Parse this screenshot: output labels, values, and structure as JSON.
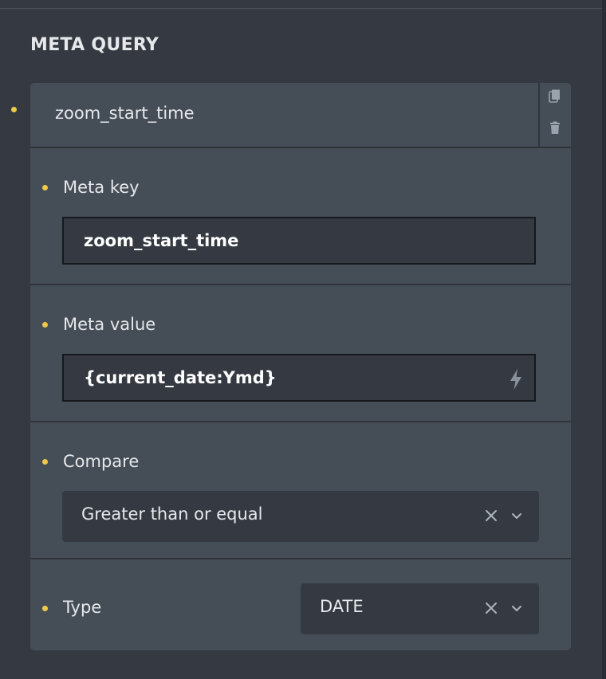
{
  "section": {
    "title": "META QUERY"
  },
  "query_item": {
    "title": "zoom_start_time",
    "actions": {
      "duplicate_icon": "copy-icon",
      "delete_icon": "trash-icon"
    }
  },
  "fields": {
    "meta_key": {
      "label": "Meta key",
      "value": "zoom_start_time"
    },
    "meta_value": {
      "label": "Meta value",
      "value": "{current_date:Ymd}",
      "icon": "bolt-icon"
    },
    "compare": {
      "label": "Compare",
      "value": "Greater than or equal"
    },
    "type": {
      "label": "Type",
      "value": "DATE"
    }
  },
  "colors": {
    "panel_bg": "#353a42",
    "card_bg": "#454d56",
    "input_bg": "#353a42",
    "accent_dot": "#f1c84a",
    "text": "#e6e8eb"
  }
}
